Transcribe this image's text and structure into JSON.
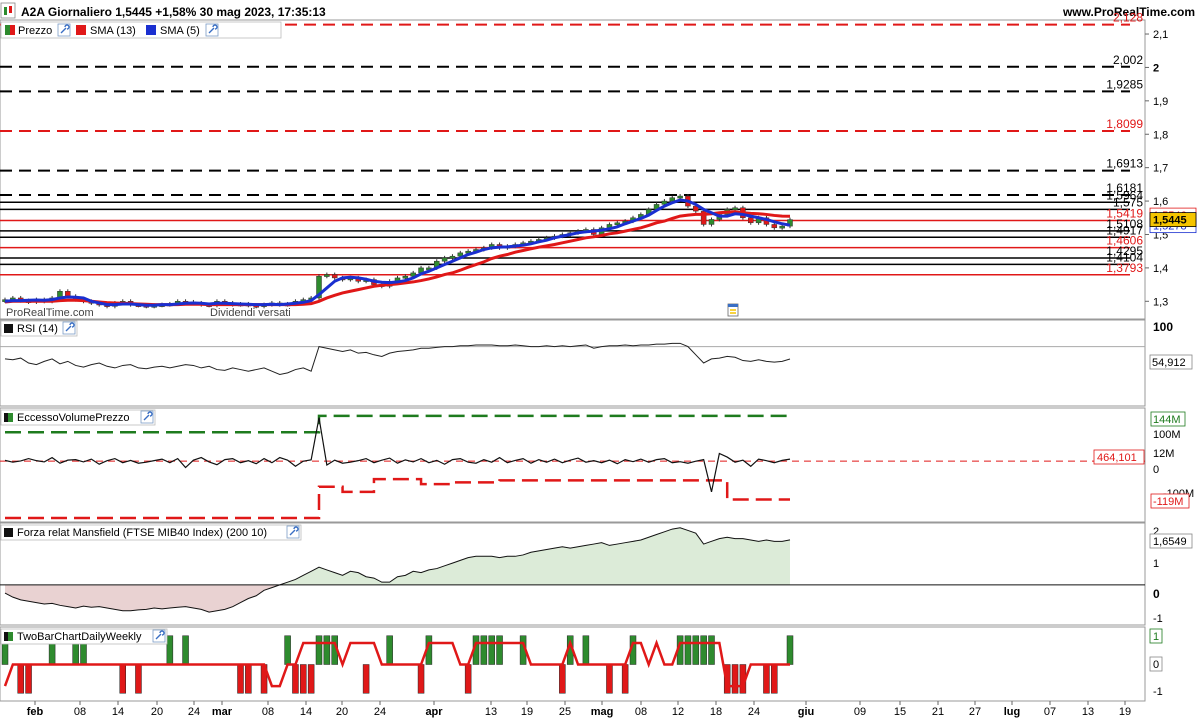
{
  "header": {
    "title": "A2A Giornaliero 1,5445 +1,58% 30 mag 2023, 17:35:13",
    "brand": "www.ProRealTime.com"
  },
  "colors": {
    "up": "#2e8b2e",
    "down": "#e01818",
    "sma13": "#e01818",
    "sma5": "#1a2fd0",
    "level_red": "#e01818",
    "level_black": "#000000",
    "mansfield_pos": "#dcebd8",
    "mansfield_neg": "#e9d2d2",
    "price_tag_bg": "#f5c400"
  },
  "x_axis": {
    "labels": [
      "feb",
      "08",
      "14",
      "20",
      "24",
      "mar",
      "08",
      "14",
      "20",
      "24",
      "apr",
      "13",
      "19",
      "25",
      "mag",
      "08",
      "12",
      "18",
      "24",
      "giu",
      "09",
      "15",
      "21",
      "27",
      "lug",
      "07",
      "13",
      "19"
    ],
    "bold": [
      "feb",
      "mar",
      "apr",
      "mag",
      "giu",
      "lug"
    ]
  },
  "charts": {
    "price": {
      "legend": [
        {
          "label": "Prezzo"
        },
        {
          "label": "SMA (13)"
        },
        {
          "label": "SMA (5)"
        }
      ],
      "watermark": "ProRealTime.com",
      "events_text": "Dividendi versati",
      "right_axis_ticks": [
        "2,1",
        "2",
        "1,9",
        "1,8",
        "1,7",
        "1,6",
        "1,5",
        "1,4",
        "1,3"
      ],
      "last_price": "1,5445",
      "sma13_value": "1,5546",
      "sma5_value": "1,5278",
      "chart_data": {
        "type": "candlestick",
        "title": "A2A Giornaliero",
        "ylim": [
          1.25,
          2.13
        ],
        "last": 1.5445,
        "change_pct": "+1,58%",
        "levels": [
          {
            "value": 2.128,
            "label": "2,128",
            "color": "red",
            "style": "dashed"
          },
          {
            "value": 2.002,
            "label": "2,002",
            "color": "black",
            "style": "dashed"
          },
          {
            "value": 1.9285,
            "label": "1,9285",
            "color": "black",
            "style": "dashed"
          },
          {
            "value": 1.8099,
            "label": "1,8099",
            "color": "red",
            "style": "dashed"
          },
          {
            "value": 1.6913,
            "label": "1,6913",
            "color": "black",
            "style": "dashed"
          },
          {
            "value": 1.6181,
            "label": "1,6181",
            "color": "black",
            "style": "dashed"
          },
          {
            "value": 1.5964,
            "label": "1,5964",
            "color": "black",
            "style": "solid"
          },
          {
            "value": 1.575,
            "label": "1,575",
            "color": "black",
            "style": "solid"
          },
          {
            "value": 1.5419,
            "label": "1,5419",
            "color": "red",
            "style": "solid"
          },
          {
            "value": 1.5108,
            "label": "1,5108",
            "color": "black",
            "style": "solid"
          },
          {
            "value": 1.4917,
            "label": "1,4917",
            "color": "black",
            "style": "solid"
          },
          {
            "value": 1.4606,
            "label": "1,4606",
            "color": "red",
            "style": "solid"
          },
          {
            "value": 1.4295,
            "label": "1,4295",
            "color": "black",
            "style": "solid"
          },
          {
            "value": 1.4104,
            "label": "1,4104",
            "color": "black",
            "style": "solid"
          },
          {
            "value": 1.3793,
            "label": "1,3793",
            "color": "red",
            "style": "solid"
          }
        ],
        "close": [
          1.305,
          1.31,
          1.302,
          1.298,
          1.305,
          1.3,
          1.31,
          1.33,
          1.315,
          1.305,
          1.3,
          1.295,
          1.29,
          1.285,
          1.295,
          1.3,
          1.29,
          1.288,
          1.285,
          1.288,
          1.29,
          1.292,
          1.3,
          1.298,
          1.295,
          1.29,
          1.288,
          1.3,
          1.295,
          1.29,
          1.292,
          1.288,
          1.285,
          1.29,
          1.295,
          1.29,
          1.292,
          1.3,
          1.305,
          1.31,
          1.375,
          1.38,
          1.37,
          1.365,
          1.37,
          1.36,
          1.365,
          1.35,
          1.345,
          1.36,
          1.37,
          1.375,
          1.385,
          1.4,
          1.4,
          1.42,
          1.43,
          1.435,
          1.445,
          1.45,
          1.455,
          1.46,
          1.47,
          1.46,
          1.465,
          1.47,
          1.475,
          1.48,
          1.485,
          1.49,
          1.495,
          1.5,
          1.505,
          1.51,
          1.515,
          1.5,
          1.52,
          1.53,
          1.535,
          1.54,
          1.55,
          1.56,
          1.575,
          1.59,
          1.6,
          1.61,
          1.615,
          1.585,
          1.57,
          1.53,
          1.545,
          1.56,
          1.575,
          1.58,
          1.55,
          1.535,
          1.55,
          1.53,
          1.52,
          1.525,
          1.5445
        ],
        "sma13": [
          1.298,
          1.3,
          1.3,
          1.3,
          1.3,
          1.3,
          1.3,
          1.302,
          1.303,
          1.303,
          1.302,
          1.3,
          1.298,
          1.296,
          1.295,
          1.294,
          1.293,
          1.292,
          1.291,
          1.29,
          1.29,
          1.29,
          1.29,
          1.291,
          1.291,
          1.291,
          1.29,
          1.29,
          1.29,
          1.29,
          1.29,
          1.29,
          1.29,
          1.29,
          1.29,
          1.29,
          1.29,
          1.29,
          1.291,
          1.293,
          1.3,
          1.31,
          1.318,
          1.325,
          1.33,
          1.335,
          1.34,
          1.345,
          1.348,
          1.35,
          1.352,
          1.355,
          1.358,
          1.362,
          1.367,
          1.373,
          1.38,
          1.385,
          1.393,
          1.402,
          1.41,
          1.418,
          1.428,
          1.435,
          1.44,
          1.447,
          1.452,
          1.457,
          1.462,
          1.466,
          1.47,
          1.475,
          1.48,
          1.485,
          1.49,
          1.493,
          1.497,
          1.502,
          1.505,
          1.51,
          1.515,
          1.52,
          1.527,
          1.535,
          1.54,
          1.548,
          1.555,
          1.558,
          1.56,
          1.56,
          1.562,
          1.565,
          1.567,
          1.568,
          1.565,
          1.563,
          1.562,
          1.56,
          1.557,
          1.555,
          1.5546
        ],
        "sma5": [
          1.3,
          1.302,
          1.302,
          1.303,
          1.304,
          1.303,
          1.305,
          1.31,
          1.313,
          1.312,
          1.31,
          1.3,
          1.295,
          1.29,
          1.29,
          1.292,
          1.292,
          1.29,
          1.288,
          1.288,
          1.29,
          1.29,
          1.292,
          1.294,
          1.295,
          1.294,
          1.292,
          1.294,
          1.294,
          1.293,
          1.292,
          1.291,
          1.29,
          1.29,
          1.291,
          1.29,
          1.292,
          1.294,
          1.297,
          1.302,
          1.32,
          1.34,
          1.36,
          1.37,
          1.372,
          1.37,
          1.366,
          1.36,
          1.357,
          1.356,
          1.358,
          1.362,
          1.37,
          1.382,
          1.39,
          1.4,
          1.41,
          1.42,
          1.43,
          1.44,
          1.447,
          1.455,
          1.46,
          1.462,
          1.463,
          1.465,
          1.468,
          1.472,
          1.478,
          1.483,
          1.49,
          1.495,
          1.5,
          1.505,
          1.508,
          1.51,
          1.513,
          1.517,
          1.523,
          1.532,
          1.54,
          1.548,
          1.558,
          1.572,
          1.585,
          1.595,
          1.603,
          1.6,
          1.59,
          1.575,
          1.565,
          1.555,
          1.555,
          1.562,
          1.56,
          1.555,
          1.55,
          1.545,
          1.538,
          1.532,
          1.5278
        ]
      }
    },
    "rsi": {
      "legend_label": "RSI (14)",
      "ticks": [
        "100"
      ],
      "value_label": "54,912",
      "chart_data": {
        "type": "line",
        "title": "RSI (14)",
        "ylim": [
          0,
          100
        ],
        "reference": 70,
        "last": 54.912,
        "values": [
          55,
          54,
          56,
          50,
          48,
          52,
          55,
          49,
          52,
          47,
          45,
          48,
          50,
          46,
          44,
          47,
          48,
          44,
          43,
          45,
          46,
          44,
          46,
          48,
          47,
          44,
          46,
          42,
          41,
          44,
          42,
          40,
          42,
          44,
          40,
          36,
          38,
          42,
          44,
          40,
          70,
          68,
          66,
          64,
          66,
          62,
          63,
          60,
          58,
          62,
          64,
          65,
          66,
          68,
          68,
          69,
          70,
          70,
          71,
          71,
          72,
          72,
          72,
          71,
          71,
          72,
          71,
          70,
          70,
          71,
          70,
          71,
          70,
          71,
          72,
          68,
          70,
          71,
          71,
          72,
          71,
          72,
          72,
          73,
          73,
          74,
          74,
          70,
          60,
          50,
          55,
          56,
          58,
          57,
          53,
          52,
          54,
          52,
          51,
          52,
          54.9
        ]
      }
    },
    "volume": {
      "legend_label": "EccessoVolumePrezzo",
      "ticks": [
        "100M",
        "12M",
        "0",
        "-100M"
      ],
      "tag_top": "144M",
      "tag_mid": "464,101",
      "tag_bottom": "-119M",
      "chart_data": {
        "type": "line",
        "title": "EccessoVolumePrezzo",
        "ylim": [
          -230,
          200
        ],
        "values": [
          3,
          -4,
          1,
          10,
          2,
          -3,
          14,
          -8,
          4,
          6,
          -3,
          8,
          -12,
          2,
          10,
          -6,
          3,
          -8,
          -4,
          2,
          8,
          -6,
          10,
          -25,
          4,
          14,
          -3,
          -14,
          6,
          10,
          -6,
          2,
          -10,
          10,
          -6,
          14,
          4,
          -20,
          0,
          5,
          170,
          -15,
          4,
          -8,
          -4,
          2,
          10,
          -6,
          4,
          12,
          -8,
          5,
          -3,
          10,
          -6,
          3,
          -12,
          6,
          10,
          -4,
          -8,
          6,
          -4,
          14,
          -6,
          3,
          10,
          -8,
          6,
          -4,
          8,
          -6,
          4,
          12,
          -4,
          2,
          -6,
          4,
          -10,
          6,
          -2,
          8,
          -4,
          6,
          10,
          -6,
          -2,
          -8,
          0,
          6,
          -120,
          30,
          16,
          -4,
          4,
          -20,
          8,
          2,
          -6,
          3,
          8
        ],
        "upper_band": [
          {
            "x0": 0,
            "x1": 40,
            "y": 113
          },
          {
            "x0": 40,
            "x1": 101,
            "y": 177
          }
        ],
        "lower_band": [
          {
            "x0": 0,
            "x1": 40,
            "y": -222
          },
          {
            "x0": 40,
            "x1": 43,
            "y": -100
          },
          {
            "x0": 43,
            "x1": 47,
            "y": -120
          },
          {
            "x0": 47,
            "x1": 53,
            "y": -70
          },
          {
            "x0": 53,
            "x1": 57,
            "y": -90
          },
          {
            "x0": 57,
            "x1": 63,
            "y": -83
          },
          {
            "x0": 63,
            "x1": 92,
            "y": -75
          },
          {
            "x0": 92,
            "x1": 101,
            "y": -150
          }
        ],
        "reference": 0,
        "last": 464.101
      }
    },
    "mansfield": {
      "legend_label": "Forza relat Mansfield (FTSE MIB40 Index) (200 10)",
      "ticks": [
        "2",
        "1",
        "0",
        "-1"
      ],
      "value_label": "1,6549",
      "chart_data": {
        "type": "area",
        "title": "Forza relat Mansfield (FTSE MIB40 Index) (200 10)",
        "ylim": [
          -1.4,
          2.2
        ],
        "last": 1.6549,
        "values": [
          -0.3,
          -0.45,
          -0.55,
          -0.6,
          -0.65,
          -0.7,
          -0.68,
          -0.75,
          -0.8,
          -0.85,
          -0.78,
          -0.82,
          -0.8,
          -0.85,
          -0.9,
          -0.95,
          -0.95,
          -0.92,
          -0.9,
          -0.85,
          -0.88,
          -0.85,
          -0.82,
          -0.8,
          -0.85,
          -0.9,
          -1.0,
          -0.95,
          -0.9,
          -0.8,
          -0.65,
          -0.5,
          -0.4,
          -0.2,
          -0.1,
          0.0,
          0.1,
          0.2,
          0.35,
          0.5,
          0.65,
          0.55,
          0.45,
          0.35,
          0.5,
          0.45,
          0.3,
          0.25,
          0.1,
          0.1,
          0.3,
          0.35,
          0.5,
          0.45,
          0.55,
          0.6,
          0.7,
          0.8,
          0.9,
          1.0,
          1.05,
          1.05,
          1.05,
          1.0,
          1.05,
          1.05,
          1.1,
          1.2,
          1.25,
          1.3,
          1.35,
          1.4,
          1.35,
          1.4,
          1.45,
          1.5,
          1.55,
          1.45,
          1.5,
          1.55,
          1.6,
          1.65,
          1.75,
          1.85,
          1.95,
          2.05,
          2.1,
          2.0,
          1.9,
          1.5,
          1.6,
          1.7,
          1.75,
          1.7,
          1.7,
          1.65,
          1.6,
          1.65,
          1.6,
          1.6,
          1.6549
        ]
      }
    },
    "twobar": {
      "legend_label": "TwoBarChartDailyWeekly",
      "ticks": [
        "1",
        "0",
        "-1"
      ],
      "tag_top": "1",
      "tag_mid": "0",
      "chart_data": {
        "type": "bar",
        "title": "TwoBarChartDailyWeekly",
        "ylim": [
          -1.2,
          1.2
        ],
        "bars": [
          1,
          0,
          -1,
          -1,
          0,
          0,
          1,
          0,
          0,
          1,
          1,
          0,
          0,
          0,
          0,
          -1,
          0,
          -1,
          0,
          0,
          0,
          1,
          0,
          1,
          0,
          0,
          0,
          0,
          0,
          0,
          -1,
          -1,
          0,
          -1,
          0,
          0,
          1,
          -1,
          -1,
          -1,
          1,
          1,
          1,
          0,
          0,
          0,
          -1,
          0,
          0,
          1,
          0,
          0,
          0,
          -1,
          1,
          0,
          0,
          0,
          0,
          -1,
          1,
          1,
          1,
          1,
          0,
          0,
          1,
          0,
          0,
          0,
          0,
          -1,
          1,
          0,
          1,
          0,
          0,
          -1,
          0,
          -1,
          1,
          0,
          0,
          0,
          0,
          0,
          1,
          1,
          1,
          1,
          1,
          0,
          -1,
          -1,
          -1,
          0,
          0,
          -1,
          -1,
          0,
          1
        ],
        "line": [
          -1,
          0,
          0,
          0,
          0,
          0,
          0,
          0,
          0,
          0,
          0,
          0,
          0,
          0,
          0,
          0,
          0,
          0,
          0,
          0,
          0,
          0,
          0,
          0,
          0,
          0,
          0,
          0,
          0,
          0,
          0,
          0,
          0,
          0,
          -1,
          -1,
          0,
          0,
          1,
          1,
          1,
          1,
          1,
          0,
          1,
          1,
          1,
          1,
          0,
          0,
          0,
          0,
          0,
          0,
          1,
          1,
          1,
          1,
          0,
          0,
          1,
          1,
          1,
          1,
          1,
          1,
          1,
          0,
          0,
          0,
          0,
          0,
          1,
          0,
          0,
          0,
          0,
          0,
          0,
          0,
          1,
          1,
          0,
          1,
          0,
          0,
          1,
          1,
          1,
          1,
          1,
          1,
          -1,
          -1,
          -1,
          0,
          0,
          0,
          0,
          0,
          0
        ]
      }
    }
  }
}
